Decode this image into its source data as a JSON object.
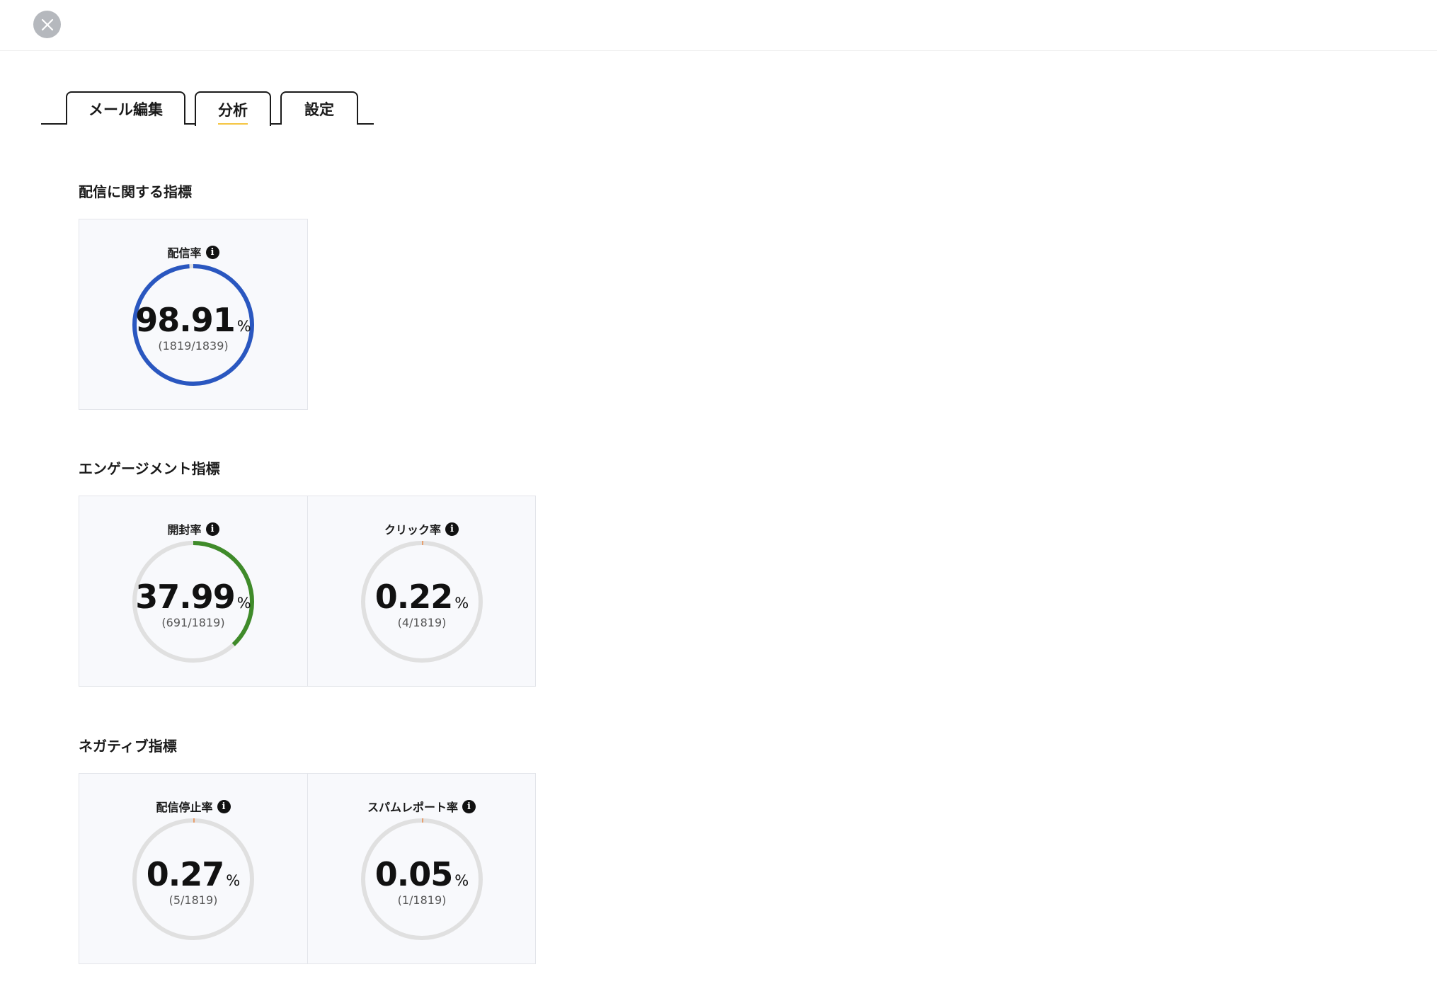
{
  "header": {
    "close_icon": "close-icon"
  },
  "tabs": [
    {
      "label": "メール編集",
      "active": false
    },
    {
      "label": "分析",
      "active": true
    },
    {
      "label": "設定",
      "active": false
    }
  ],
  "colors": {
    "delivery": "#2a57c0",
    "open": "#3f8b2a",
    "track": "#e0e0e0",
    "low": "#e8a070",
    "tab_underline": "#f5c542"
  },
  "sections": [
    {
      "title": "配信に関する指標",
      "metrics": [
        {
          "label": "配信率",
          "value": "98.91",
          "unit": "%",
          "ratio": "(1819/1839)",
          "fraction": 0.9891,
          "color": "#2a57c0"
        }
      ]
    },
    {
      "title": "エンゲージメント指標",
      "metrics": [
        {
          "label": "開封率",
          "value": "37.99",
          "unit": "%",
          "ratio": "(691/1819)",
          "fraction": 0.3799,
          "color": "#3f8b2a"
        },
        {
          "label": "クリック率",
          "value": "0.22",
          "unit": "%",
          "ratio": "(4/1819)",
          "fraction": 0.0022,
          "color": "#e8a070"
        }
      ]
    },
    {
      "title": "ネガティブ指標",
      "metrics": [
        {
          "label": "配信停止率",
          "value": "0.27",
          "unit": "%",
          "ratio": "(5/1819)",
          "fraction": 0.0027,
          "color": "#e8a070"
        },
        {
          "label": "スパムレポート率",
          "value": "0.05",
          "unit": "%",
          "ratio": "(1/1819)",
          "fraction": 0.0005,
          "color": "#e8a070"
        }
      ]
    }
  ]
}
